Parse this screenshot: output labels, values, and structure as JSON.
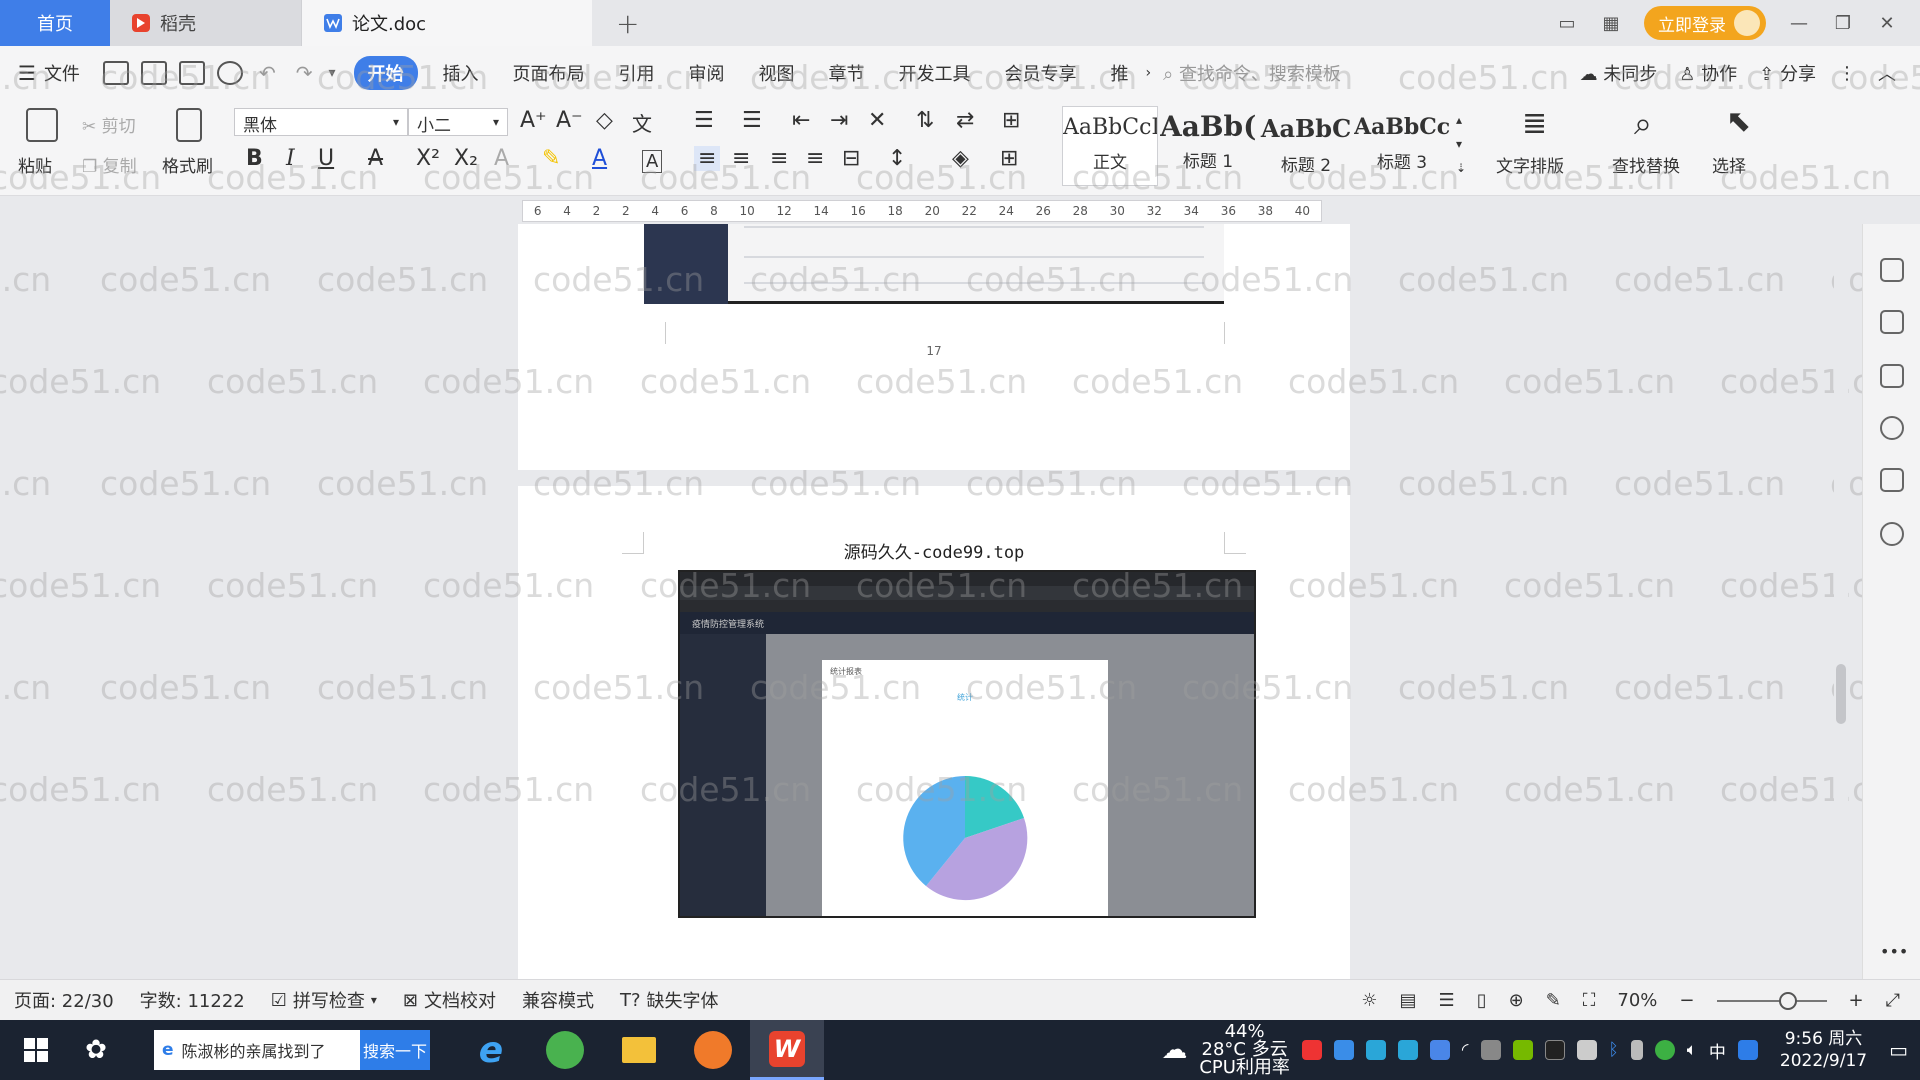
{
  "tabs": {
    "home": "首页",
    "daoke": "稻壳",
    "doc": "论文.doc",
    "add": "+"
  },
  "window": {
    "login": "立即登录"
  },
  "menu": {
    "file": "文件",
    "items": [
      "开始",
      "插入",
      "页面布局",
      "引用",
      "审阅",
      "视图",
      "章节",
      "开发工具",
      "会员专享",
      "推"
    ],
    "search_cmd": "查找命令、搜索模板",
    "unsynced": "未同步",
    "collab": "协作",
    "share": "分享"
  },
  "ribbon": {
    "paste": "粘贴",
    "cut": "剪切",
    "copy": "复制",
    "format_painter": "格式刷",
    "font_name": "黑体",
    "font_size": "小二",
    "styles": [
      {
        "sample": "AaBbCcI",
        "label": "正文"
      },
      {
        "sample": "AaBb(",
        "label": "标题 1"
      },
      {
        "sample": "AaBbC",
        "label": "标题 2"
      },
      {
        "sample": "AaBbCcl",
        "label": "标题 3"
      }
    ],
    "text_layout": "文字排版",
    "find_replace": "查找替换",
    "select": "选择"
  },
  "ruler": {
    "ticks": [
      "6",
      "4",
      "2",
      "2",
      "4",
      "6",
      "8",
      "10",
      "12",
      "14",
      "16",
      "18",
      "20",
      "22",
      "24",
      "26",
      "28",
      "30",
      "32",
      "34",
      "36",
      "38",
      "40"
    ]
  },
  "document": {
    "page_number": "17",
    "caption": "源码久久-code99.top",
    "shot": {
      "app_title": "疫情防控管理系统",
      "modal_title": "统计报表",
      "chart_title": "统计"
    }
  },
  "watermark": "code51.cn",
  "status": {
    "page": "页面: 22/30",
    "words": "字数: 11222",
    "spell": "拼写检查",
    "proof": "文档校对",
    "compat": "兼容模式",
    "missing_font": "缺失字体",
    "zoom": "70%"
  },
  "taskbar": {
    "search_text": "陈淑彬的亲属找到了",
    "search_btn": "搜索一下",
    "weather_temp": "28°C 多云",
    "cpu": "44%",
    "cpu_label": "CPU利用率",
    "ime": "中",
    "time": "9:56 周六",
    "date": "2022/9/17"
  },
  "colors": {
    "accent": "#3f7ee8",
    "login": "#f3a51e",
    "wps_red": "#e8432e",
    "pie_cyan": "#36c9c6",
    "pie_purple": "#b7a2e0",
    "pie_blue": "#5ab1ef"
  }
}
